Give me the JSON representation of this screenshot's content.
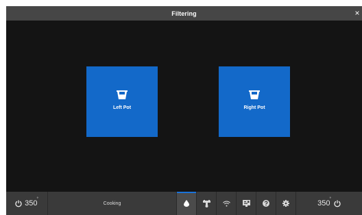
{
  "window": {
    "title": "Filtering",
    "close_label": "×"
  },
  "pots": {
    "left": {
      "label": "Left Pot",
      "icon": "pot-icon"
    },
    "right": {
      "label": "Right Pot",
      "icon": "pot-icon"
    }
  },
  "bottom_bar": {
    "left_temp": {
      "value": "350",
      "unit": "°",
      "icon": "power-icon"
    },
    "status": "Cooking",
    "right_temp": {
      "value": "350",
      "unit": "°",
      "icon": "power-icon"
    },
    "icons": [
      "oil-drop-icon",
      "thermometer-icon",
      "wifi-icon",
      "display-icon",
      "help-icon",
      "settings-icon"
    ],
    "active_icon": "oil-drop-icon"
  },
  "colors": {
    "accent": "#1369c9",
    "titlebar": "#464646",
    "background": "#141414",
    "bottombar": "#3a3a3a"
  }
}
